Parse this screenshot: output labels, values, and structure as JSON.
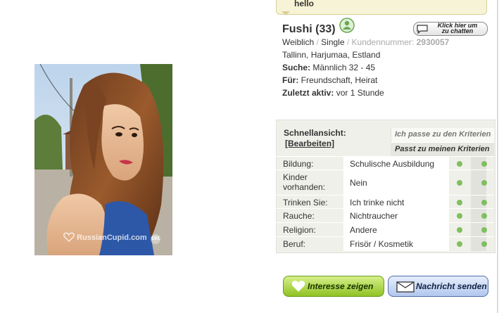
{
  "message": {
    "text": "hello"
  },
  "photo": {
    "watermark": "RussianCupid.com",
    "badge": "191"
  },
  "profile": {
    "name_age": "Fushi (33)",
    "gender": "Weiblich",
    "separator": " / ",
    "status": "Single",
    "customer_label": "Kundennummer:",
    "customer_number": "2930057",
    "location": "Tallinn, Harjumaa, Estland",
    "seeking_label": "Suche:",
    "seeking_value": "Männlich 32 - 45",
    "for_label": "Für:",
    "for_value": "Freundschaft, Heirat",
    "last_active_label": "Zuletzt aktiv:",
    "last_active_value": "vor 1 Stunde"
  },
  "chat_button": {
    "line1": "Klick hier um",
    "line2": "zu chatten"
  },
  "quick_view": {
    "heading": "Schnellansicht:",
    "edit_label": "[Bearbeiten]",
    "criteria_mine": "Ich passe zu den Kriterien",
    "criteria_theirs": "Passt zu meinen Kriterien",
    "rows": [
      {
        "label": "Bildung:",
        "value": "Schulische Ausbildung"
      },
      {
        "label": "Kinder vorhanden:",
        "value": "Nein"
      },
      {
        "label": "Trinken Sie:",
        "value": "Ich trinke nicht"
      },
      {
        "label": "Rauche:",
        "value": "Nichtraucher"
      },
      {
        "label": "Religion:",
        "value": "Andere"
      },
      {
        "label": "Beruf:",
        "value": "Frisör / Kosmetik"
      }
    ]
  },
  "actions": {
    "interest_label": "Interesse zeigen",
    "message_label": "Nachricht senden"
  },
  "colors": {
    "match_dot": "#7fbf5f",
    "interest_button": "#8fc224",
    "message_button": "#b2c7ee",
    "panel_bg": "#f0f0ea"
  },
  "icons": [
    "person-icon",
    "speech-bubble-icon",
    "heart-icon",
    "envelope-icon"
  ]
}
